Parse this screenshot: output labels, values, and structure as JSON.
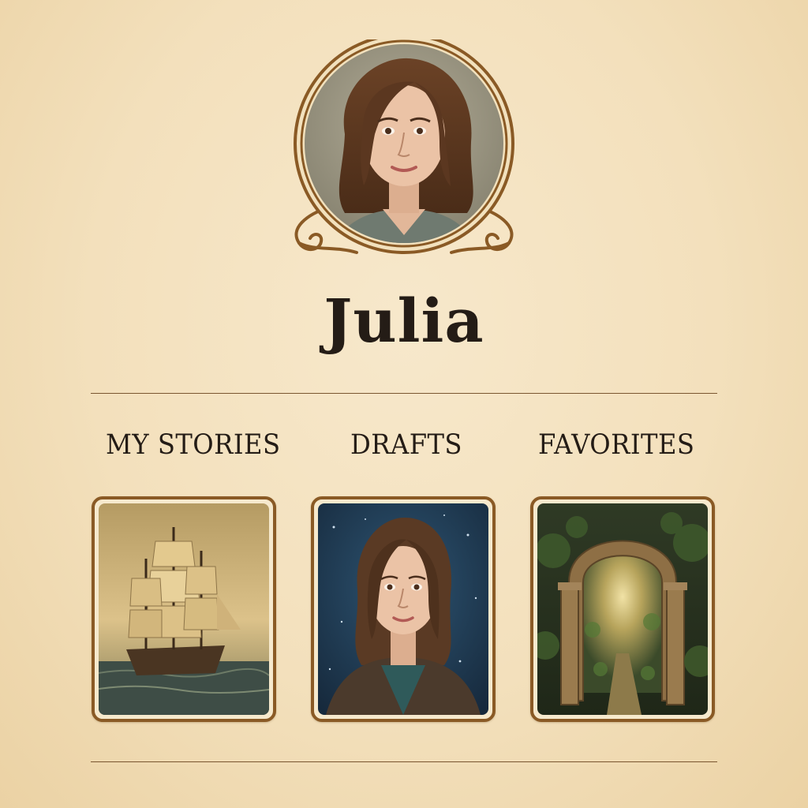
{
  "profile": {
    "name": "Julia",
    "avatar_icon": "portrait-avatar"
  },
  "tabs": [
    {
      "label": "MY STORIES"
    },
    {
      "label": "DRAFTS"
    },
    {
      "label": "FAVORITES"
    }
  ],
  "cards": [
    {
      "icon": "sailing-ship-image"
    },
    {
      "icon": "girl-portrait-image"
    },
    {
      "icon": "stone-archway-image"
    }
  ],
  "colors": {
    "background": "#f3e0bc",
    "frame": "#8a5a25",
    "text": "#241c16",
    "rule": "#7a5630"
  }
}
